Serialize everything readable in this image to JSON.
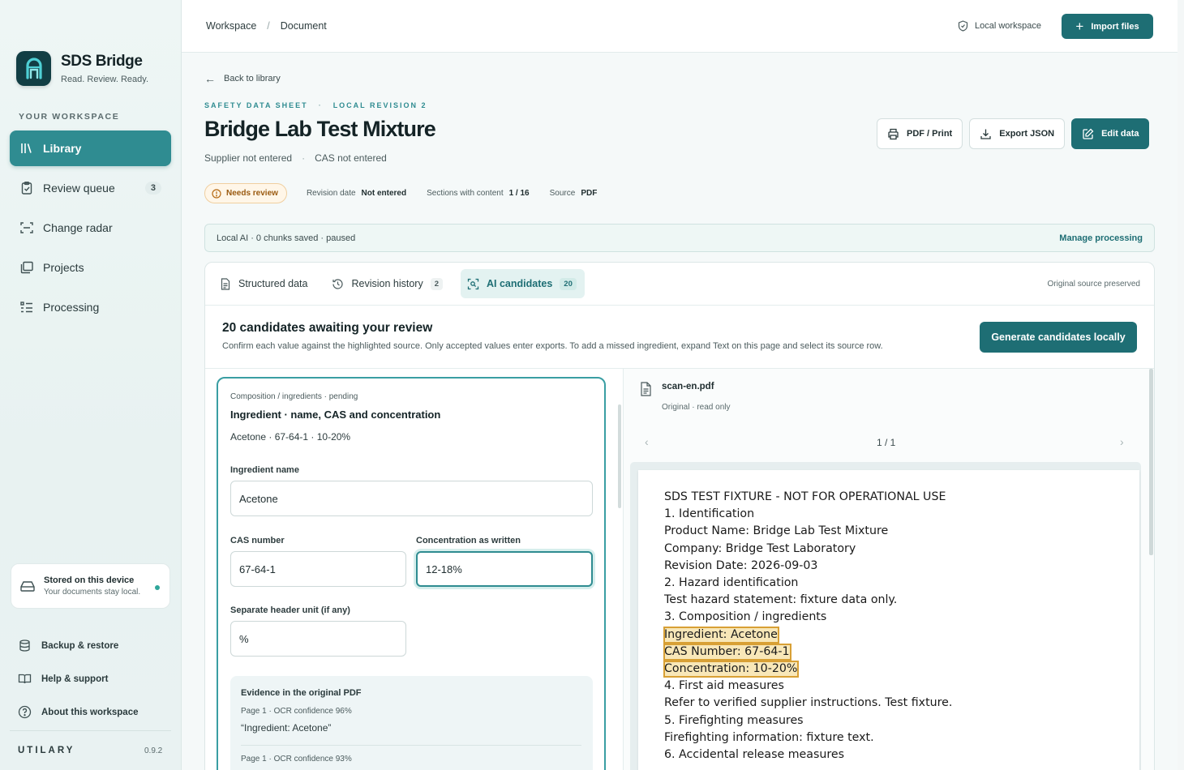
{
  "app": {
    "name": "SDS Bridge",
    "tagline": "Read. Review. Ready."
  },
  "sidebar": {
    "heading": "YOUR WORKSPACE",
    "items": [
      {
        "label": "Library",
        "icon": "library-icon",
        "active": true
      },
      {
        "label": "Review queue",
        "icon": "clipboard-icon",
        "count": "3"
      },
      {
        "label": "Change radar",
        "icon": "scan-icon"
      },
      {
        "label": "Projects",
        "icon": "folders-icon"
      },
      {
        "label": "Processing",
        "icon": "list-icon"
      }
    ],
    "storage": {
      "title": "Stored on this device",
      "subtitle": "Your documents stay local."
    },
    "links": [
      {
        "label": "Backup & restore",
        "icon": "database-icon"
      },
      {
        "label": "Help & support",
        "icon": "book-icon"
      },
      {
        "label": "About this workspace",
        "icon": "help-circle-icon"
      }
    ],
    "footer": {
      "brand": "UTILARY",
      "version": "0.9.2"
    }
  },
  "topbar": {
    "breadcrumb": [
      "Workspace",
      "Document"
    ],
    "separator": "/",
    "workspace_status": "Local workspace",
    "import_label": "Import files"
  },
  "document": {
    "back_label": "Back to library",
    "eyebrow": [
      "SAFETY DATA SHEET",
      "LOCAL REVISION 2"
    ],
    "title": "Bridge Lab Test Mixture",
    "supplier": "Supplier not entered",
    "cas": "CAS not entered",
    "actions": {
      "print": "PDF / Print",
      "export": "Export JSON",
      "edit": "Edit data"
    },
    "status_badge": "Needs review",
    "meta": [
      {
        "label": "Revision date",
        "value": "Not entered"
      },
      {
        "label": "Sections with content",
        "value": "1 / 16"
      },
      {
        "label": "Source",
        "value": "PDF"
      }
    ],
    "ai_status": "Local AI · 0 chunks saved · paused",
    "ai_link": "Manage processing"
  },
  "tabs": {
    "items": [
      {
        "label": "Structured data",
        "icon": "document-icon"
      },
      {
        "label": "Revision history",
        "icon": "history-icon",
        "count": "2"
      },
      {
        "label": "AI candidates",
        "icon": "scan-search-icon",
        "count": "20",
        "active": true
      }
    ],
    "note": "Original source preserved"
  },
  "review": {
    "title": "20 candidates awaiting your review",
    "subtitle": "Confirm each value against the highlighted source. Only accepted values enter exports. To add a missed ingredient, expand Text on this page and select its source row.",
    "generate_label": "Generate candidates locally"
  },
  "candidate": {
    "eyebrow": "Composition / ingredients · pending",
    "title": "Ingredient · name, CAS and concentration",
    "summary": "Acetone · 67-64-1 · 10-20%",
    "fields": {
      "name": {
        "label": "Ingredient name",
        "value": "Acetone"
      },
      "cas": {
        "label": "CAS number",
        "value": "67-64-1"
      },
      "concentration": {
        "label": "Concentration as written",
        "value": "12-18%"
      },
      "unit": {
        "label": "Separate header unit (if any)",
        "value": "%"
      }
    },
    "evidence": {
      "title": "Evidence in the original PDF",
      "items": [
        {
          "meta": "Page 1 · OCR confidence 96%",
          "quote": "“Ingredient: Acetone”"
        },
        {
          "meta": "Page 1 · OCR confidence 93%"
        }
      ]
    }
  },
  "viewer": {
    "file_name": "scan-en.pdf",
    "file_sub": "Original · read only",
    "page_indicator": "1 / 1",
    "lines": [
      "SDS TEST FIXTURE - NOT FOR OPERATIONAL USE",
      "1. Identification",
      "Product Name: Bridge Lab Test Mixture",
      "Company: Bridge Test Laboratory",
      "Revision Date: 2026-09-03",
      "2. Hazard identification",
      "Test hazard statement: fixture data only.",
      "3. Composition / ingredients",
      "Ingredient: Acetone",
      "CAS Number: 67-64-1",
      "Concentration: 10-20%",
      "4. First aid measures",
      "Refer to verified supplier instructions. Test fixture.",
      "5. Firefighting measures",
      "Firefighting information: fixture text.",
      "6. Accidental release measures"
    ],
    "highlight_color": "#d8a035"
  },
  "colors": {
    "accent": "#1e6e74",
    "accent_light": "#2f8c91",
    "warning": "#9a5a10"
  }
}
